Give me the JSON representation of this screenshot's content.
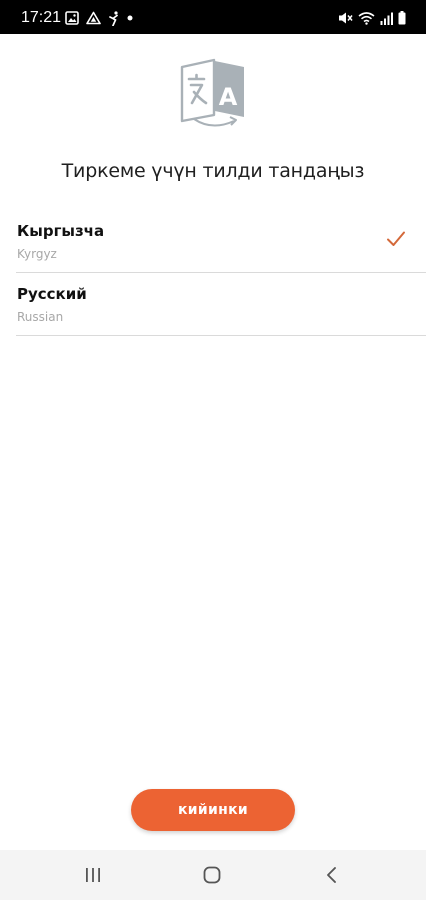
{
  "status_bar": {
    "time": "17:21",
    "icons_left": [
      "image-icon",
      "drive-icon",
      "activity-icon",
      "dot-icon"
    ],
    "icons_right": [
      "mute-icon",
      "wifi-icon",
      "signal-icon",
      "battery-icon"
    ]
  },
  "header": {
    "icon": "translate-icon",
    "title": "Тиркеме үчүн тилди тандаңыз"
  },
  "languages": [
    {
      "native": "Кыргызча",
      "english": "Kyrgyz",
      "selected": true
    },
    {
      "native": "Русский",
      "english": "Russian",
      "selected": false
    }
  ],
  "actions": {
    "continue_label": "кийинки"
  },
  "colors": {
    "accent": "#ec6333",
    "check": "#d4693a",
    "divider": "#dadada",
    "icon_gray": "#a9b1b7"
  },
  "nav_bar": {
    "buttons": [
      "recent-apps-icon",
      "home-icon",
      "back-icon"
    ]
  }
}
